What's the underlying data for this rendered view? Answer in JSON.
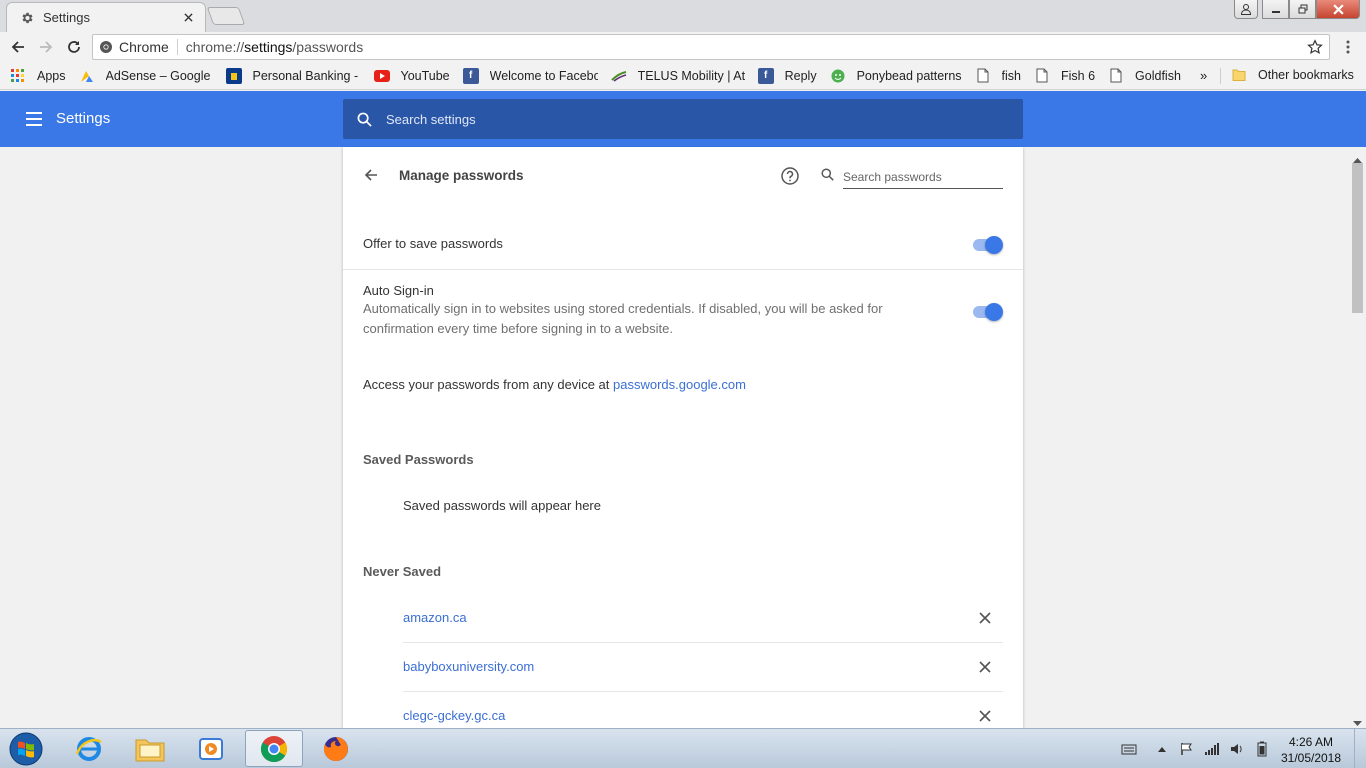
{
  "browser": {
    "tab_title": "Settings",
    "omnibox_chip": "Chrome",
    "url_prefix": "chrome://",
    "url_host": "settings",
    "url_path": "/passwords"
  },
  "bookmarks": {
    "items": [
      {
        "label": "Apps",
        "icon": "apps-grid-icon"
      },
      {
        "label": "AdSense – Google A",
        "icon": "adsense-icon"
      },
      {
        "label": "Personal Banking - A",
        "icon": "bank-icon"
      },
      {
        "label": "YouTube",
        "icon": "youtube-icon"
      },
      {
        "label": "Welcome to Facebo",
        "icon": "facebook-icon"
      },
      {
        "label": "TELUS Mobility | At T",
        "icon": "telus-icon"
      },
      {
        "label": "Reply",
        "icon": "facebook-icon"
      },
      {
        "label": "Ponybead patterns",
        "icon": "smiley-icon"
      },
      {
        "label": "fish",
        "icon": "page-icon"
      },
      {
        "label": "Fish 6",
        "icon": "page-icon"
      },
      {
        "label": "Goldfish",
        "icon": "page-icon"
      }
    ],
    "overflow": "»",
    "other": "Other bookmarks"
  },
  "settings_header": {
    "title": "Settings",
    "search_placeholder": "Search settings"
  },
  "manage_passwords": {
    "title": "Manage passwords",
    "search_placeholder": "Search passwords",
    "offer_to_save": {
      "label": "Offer to save passwords",
      "enabled": true
    },
    "auto_signin": {
      "label": "Auto Sign-in",
      "description": "Automatically sign in to websites using stored credentials. If disabled, you will be asked for confirmation every time before signing in to a website.",
      "enabled": true
    },
    "access_text": "Access your passwords from any device at ",
    "access_link": "passwords.google.com",
    "saved_title": "Saved Passwords",
    "saved_empty": "Saved passwords will appear here",
    "never_title": "Never Saved",
    "never_saved": [
      "amazon.ca",
      "babyboxuniversity.com",
      "clegc-gckey.gc.ca"
    ]
  },
  "taskbar": {
    "time": "4:26 AM",
    "date": "31/05/2018"
  },
  "colors": {
    "accent": "#3b78e7",
    "search_bg": "#2a56a8",
    "link": "#3b6fd4"
  }
}
